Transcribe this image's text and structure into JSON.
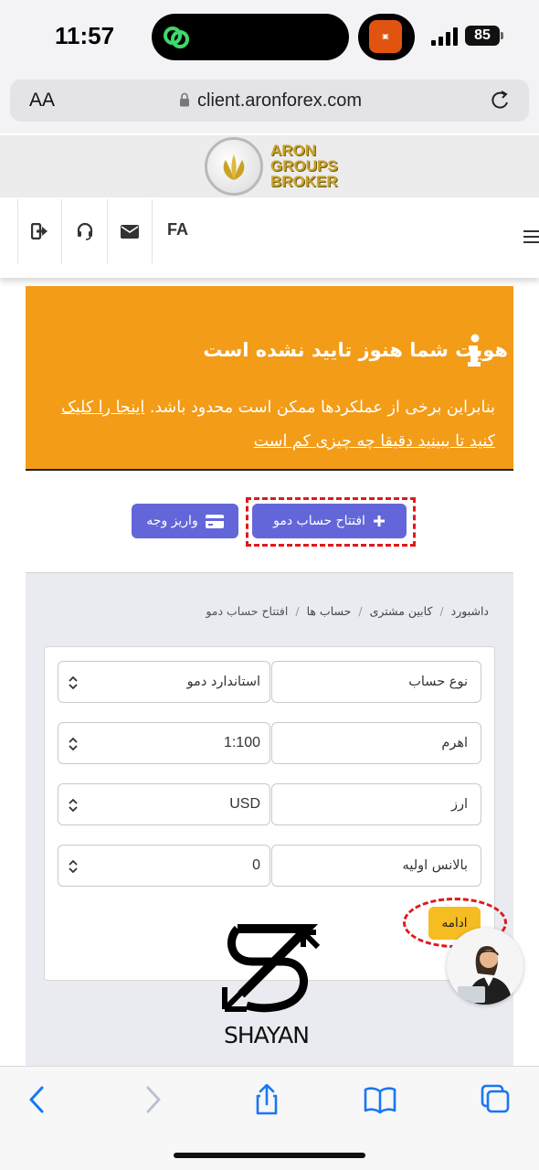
{
  "status_bar": {
    "time": "11:57",
    "battery": "85"
  },
  "browser": {
    "aa_label": "AA",
    "url": "client.aronforex.com"
  },
  "logo": {
    "line1": "ARON",
    "line2": "GROUPS",
    "line3": "BROKER"
  },
  "nav": {
    "language": "FA"
  },
  "alert": {
    "title": "هویت شما هنوز تایید نشده است",
    "body_text": "بنابراین برخی از عملکردها ممکن است محدود باشد.",
    "link_text": "اینجا را کلیک کنید تا ببینید دقیقا چه چیزی کم است"
  },
  "actions": {
    "open_demo_label": "افتتاح حساب دمو",
    "deposit_label": "واریز وجه"
  },
  "breadcrumb": {
    "items": [
      "داشبورد",
      "کابین مشتری",
      "حساب ها",
      "افتتاح حساب دمو"
    ]
  },
  "form": {
    "fields": [
      {
        "label": "نوع حساب",
        "value": "استاندارد دمو"
      },
      {
        "label": "اهرم",
        "value": "1:100"
      },
      {
        "label": "ارز",
        "value": "USD"
      },
      {
        "label": "بالانس اولیه",
        "value": "0"
      }
    ],
    "continue_label": "ادامه"
  },
  "watermark": {
    "text": "SHAYAN"
  },
  "colors": {
    "alert_bg": "#f39c17",
    "primary_button": "#6366d8",
    "continue_button": "#f5bd22",
    "highlight_dashes": "#e0191b"
  }
}
